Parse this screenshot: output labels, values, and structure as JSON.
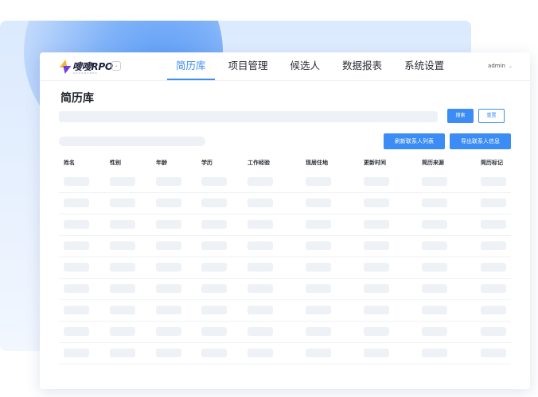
{
  "app": {
    "logo_text": "嗖嗖RPO",
    "logo_sub": "SOUSOURPO"
  },
  "nav": {
    "tabs": [
      {
        "label": "简历库",
        "active": true
      },
      {
        "label": "项目管理",
        "active": false
      },
      {
        "label": "候选人",
        "active": false
      },
      {
        "label": "数据报表",
        "active": false
      },
      {
        "label": "系统设置",
        "active": false
      }
    ],
    "user": "admin"
  },
  "page": {
    "title": "简历库"
  },
  "toolbar": {
    "search_label": "搜索",
    "reset_label": "重置",
    "refresh_label": "刷新联系人列表",
    "export_label": "导出联系人信息"
  },
  "table": {
    "columns": [
      "姓名",
      "性别",
      "年龄",
      "学历",
      "工作经验",
      "现居住地",
      "更新时间",
      "简历来源",
      "简历标记"
    ],
    "row_count": 9
  },
  "colors": {
    "accent": "#3b8cf5",
    "placeholder": "#eef1f5",
    "background_panel": "#dbeafe"
  },
  "icons": {
    "logo": "lightning-bolt-icon",
    "logo_dropdown": "chevron-down-icon",
    "user_dropdown": "chevron-down-icon"
  }
}
